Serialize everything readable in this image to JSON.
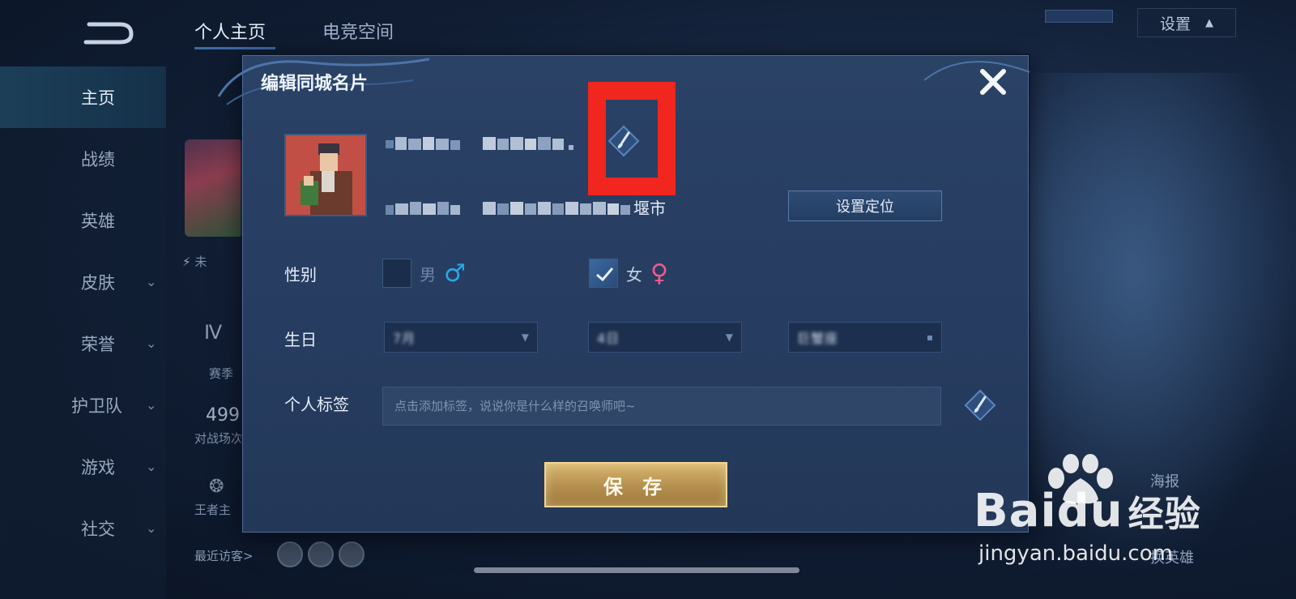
{
  "top_tabs": [
    {
      "label": "个人主页",
      "active": true
    },
    {
      "label": "电竞空间",
      "active": false
    }
  ],
  "settings": {
    "label": "设置"
  },
  "sidebar": {
    "items": [
      {
        "label": "主页",
        "active": true,
        "has_chevron": false
      },
      {
        "label": "战绩",
        "active": false,
        "has_chevron": false
      },
      {
        "label": "英雄",
        "active": false,
        "has_chevron": false
      },
      {
        "label": "皮肤",
        "active": false,
        "has_chevron": true
      },
      {
        "label": "荣誉",
        "active": false,
        "has_chevron": true
      },
      {
        "label": "护卫队",
        "active": false,
        "has_chevron": true
      },
      {
        "label": "游戏",
        "active": false,
        "has_chevron": true
      },
      {
        "label": "社交",
        "active": false,
        "has_chevron": true
      }
    ]
  },
  "left_panel": {
    "status_text": "未",
    "season_text": "赛季",
    "battles_value": "499",
    "battles_label": "对战场次",
    "king_text": "王者主",
    "recent_visitors_label": "最近访客>"
  },
  "right_side": {
    "poster_label": "海报",
    "hero_label": "换英雄"
  },
  "dialog": {
    "title": "编辑同城名片",
    "close_icon": "close-icon",
    "city_suffix": "堰市",
    "set_location_label": "设置定位",
    "gender": {
      "label": "性别",
      "options": [
        {
          "text": "男",
          "symbol": "♂",
          "color": "#29a8e8",
          "checked": false
        },
        {
          "text": "女",
          "symbol": "♀",
          "color": "#f25a8a",
          "checked": true
        }
      ]
    },
    "birthday": {
      "label": "生日",
      "selects": [
        {
          "value": "7月"
        },
        {
          "value": "4日"
        },
        {
          "value": "巨蟹座"
        }
      ]
    },
    "tags": {
      "label": "个人标签",
      "placeholder": "点击添加标签，说说你是什么样的召唤师吧~"
    },
    "save_label": "保 存"
  },
  "watermark": {
    "brand": "Bai",
    "brand_du": "du",
    "brand_cn": "经验",
    "url": "jingyan.baidu.com"
  },
  "colors": {
    "accent_red": "#f0261f",
    "gold": "#c9a45e",
    "male": "#29a8e8",
    "female": "#f25a8a"
  }
}
